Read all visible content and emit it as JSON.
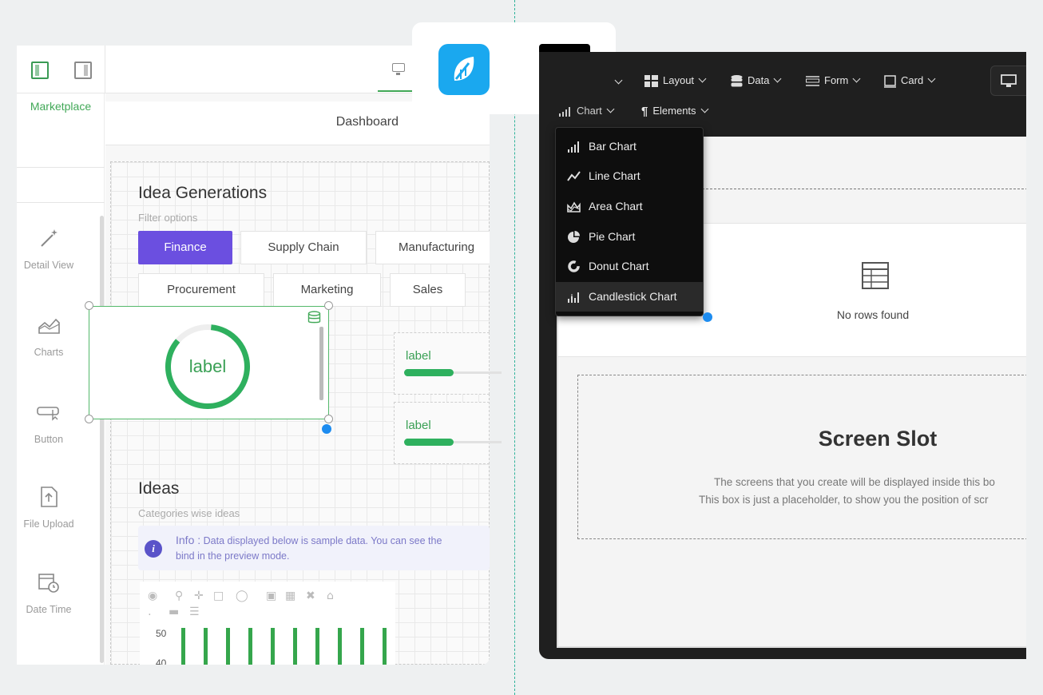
{
  "left": {
    "sidebar_tab": "Marketplace",
    "sidebar_items": [
      {
        "label": "Detail View",
        "icon": "magic-wand-icon"
      },
      {
        "label": "Charts",
        "icon": "area-chart-icon"
      },
      {
        "label": "Button",
        "icon": "button-click-icon"
      },
      {
        "label": "File Upload",
        "icon": "file-upload-icon"
      },
      {
        "label": "Date Time",
        "icon": "calendar-clock-icon"
      }
    ],
    "page_title": "Dashboard",
    "section1": {
      "title": "Idea Generations",
      "subtitle": "Filter options",
      "filters": [
        "Finance",
        "Supply Chain",
        "Manufacturing",
        "Procurement",
        "Marketing",
        "Sales"
      ],
      "active_filter": "Finance"
    },
    "widget": {
      "label": "label",
      "progress": 0.85
    },
    "mini_widgets": [
      {
        "label": "label",
        "progress": 0.45
      },
      {
        "label": "label",
        "progress": 0.45
      }
    ],
    "section2": {
      "title": "Ideas",
      "subtitle": "Categories wise ideas",
      "info_prefix": "Info :",
      "info_line1": "Data displayed below is sample data. You can see the",
      "info_line2": "bind in the preview mode."
    },
    "chart_data": {
      "type": "bar",
      "ytick_labels": [
        "50",
        "40"
      ],
      "bar_count": 10
    },
    "accent": "#6b4fe0",
    "green": "#41a857"
  },
  "logos": {
    "first": "budibase-style-blue-logo",
    "second": "bb"
  },
  "right": {
    "toolbar": {
      "layout": "Layout",
      "data": "Data",
      "form": "Form",
      "card": "Card",
      "chart": "Chart",
      "elements": "Elements"
    },
    "chart_menu": [
      "Bar Chart",
      "Line Chart",
      "Area Chart",
      "Pie Chart",
      "Donut Chart",
      "Candlestick Chart"
    ],
    "highlighted_item": "Candlestick Chart",
    "table_empty": "No rows found",
    "slot": {
      "title": "Screen Slot",
      "line1": "The screens that you create will be displayed inside this bo",
      "line2": "This box is just a placeholder, to show you the position of scr"
    }
  }
}
